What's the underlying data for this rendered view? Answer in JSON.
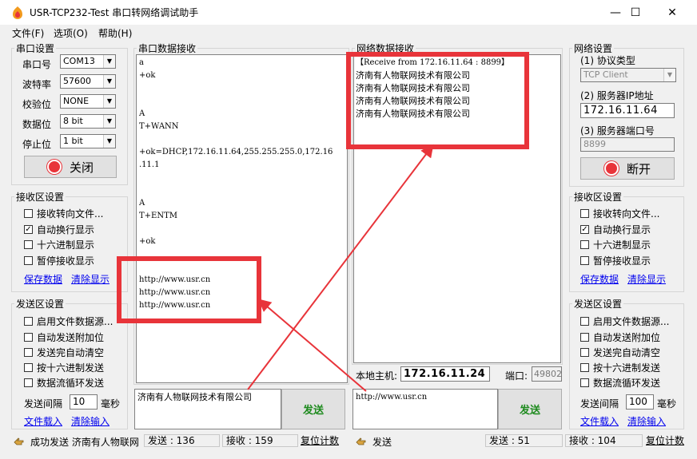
{
  "window": {
    "title": "USR-TCP232-Test 串口转网络调试助手",
    "minimize": "—",
    "maximize": "☐",
    "close": "✕"
  },
  "menu": [
    "文件(F)",
    "选项(O)",
    "帮助(H)"
  ],
  "serial_settings": {
    "legend": "串口设置",
    "port_label": "串口号",
    "port_value": "COM13",
    "baud_label": "波特率",
    "baud_value": "57600",
    "parity_label": "校验位",
    "parity_value": "NONE",
    "databits_label": "数据位",
    "databits_value": "8 bit",
    "stopbits_label": "停止位",
    "stopbits_value": "1 bit",
    "close_button": "关闭"
  },
  "left_recv_settings": {
    "legend": "接收区设置",
    "options": [
      {
        "label": "接收转向文件...",
        "checked": false
      },
      {
        "label": "自动换行显示",
        "checked": true
      },
      {
        "label": "十六进制显示",
        "checked": false
      },
      {
        "label": "暂停接收显示",
        "checked": false
      }
    ],
    "save_link": "保存数据",
    "clear_link": "清除显示"
  },
  "left_send_settings": {
    "legend": "发送区设置",
    "options": [
      {
        "label": "启用文件数据源...",
        "checked": false
      },
      {
        "label": "自动发送附加位",
        "checked": false
      },
      {
        "label": "发送完自动清空",
        "checked": false
      },
      {
        "label": "按十六进制发送",
        "checked": false
      },
      {
        "label": "数据流循环发送",
        "checked": false
      }
    ],
    "interval_label": "发送间隔",
    "interval_value": "10",
    "interval_unit": "毫秒",
    "load_link": "文件载入",
    "clear_link": "清除输入"
  },
  "serial_recv": {
    "legend": "串口数据接收",
    "text": "a\n+ok\n\n\nA\nT+WANN\n\n+ok=DHCP,172.16.11.64,255.255.255.0,172.16\n.11.1\n\n\nA\nT+ENTM\n\n+ok\n\n\nhttp://www.usr.cn\nhttp://www.usr.cn\nhttp://www.usr.cn"
  },
  "net_recv": {
    "legend": "网络数据接收",
    "header": "【Receive from 172.16.11.64 : 8899】",
    "lines": [
      "济南有人物联网技术有限公司",
      "济南有人物联网技术有限公司",
      "济南有人物联网技术有限公司",
      "济南有人物联网技术有限公司"
    ]
  },
  "local_host": {
    "label": "本地主机",
    "ip": "172.16.11.24",
    "port_label": "端口",
    "port_value": "49802"
  },
  "serial_send": {
    "text": "济南有人物联网技术有限公司",
    "button": "发送"
  },
  "net_send": {
    "text": "http://www.usr.cn",
    "button": "发送"
  },
  "net_settings": {
    "legend": "网络设置",
    "protocol_label": "(1) 协议类型",
    "protocol_value": "TCP Client",
    "server_ip_label": "(2) 服务器IP地址",
    "server_ip_value": "172.16.11.64",
    "server_port_label": "(3) 服务器端口号",
    "server_port_value": "8899",
    "disconnect_button": "断开"
  },
  "right_recv_settings": {
    "legend": "接收区设置",
    "options": [
      {
        "label": "接收转向文件...",
        "checked": false
      },
      {
        "label": "自动换行显示",
        "checked": true
      },
      {
        "label": "十六进制显示",
        "checked": false
      },
      {
        "label": "暂停接收显示",
        "checked": false
      }
    ],
    "save_link": "保存数据",
    "clear_link": "清除显示"
  },
  "right_send_settings": {
    "legend": "发送区设置",
    "options": [
      {
        "label": "启用文件数据源...",
        "checked": false
      },
      {
        "label": "自动发送附加位",
        "checked": false
      },
      {
        "label": "发送完自动清空",
        "checked": false
      },
      {
        "label": "按十六进制发送",
        "checked": false
      },
      {
        "label": "数据流循环发送",
        "checked": false
      }
    ],
    "interval_label": "发送间隔",
    "interval_value": "100",
    "interval_unit": "毫秒",
    "load_link": "文件载入",
    "clear_link": "清除输入"
  },
  "status_left": {
    "message": "成功发送 济南有人物联网",
    "send_count": "发送 : 136",
    "recv_count": "接收 : 159",
    "reset": "复位计数"
  },
  "status_right": {
    "message": "发送",
    "send_count": "发送 : 51",
    "recv_count": "接收 : 104",
    "reset": "复位计数"
  },
  "colors": {
    "annotation_red": "#e8343a",
    "send_green": "#1d8a1d",
    "link_blue": "#0000ee"
  }
}
